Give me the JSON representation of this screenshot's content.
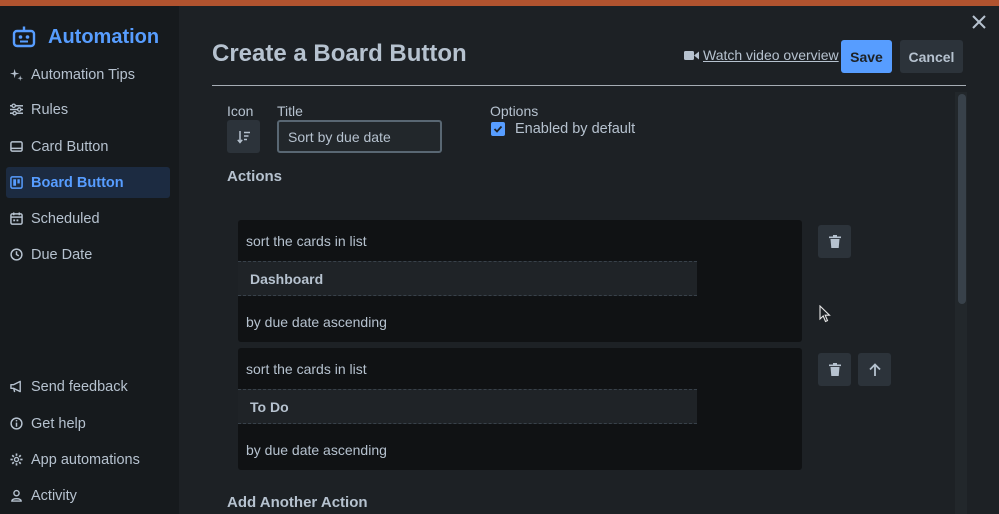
{
  "sidebar": {
    "brand": {
      "title": "Automation",
      "icon": "robot-icon"
    },
    "items": [
      {
        "label": "Automation Tips",
        "icon": "sparkle-icon",
        "active": false
      },
      {
        "label": "Rules",
        "icon": "sliders-icon",
        "active": false
      },
      {
        "label": "Card Button",
        "icon": "card-icon",
        "active": false
      },
      {
        "label": "Board Button",
        "icon": "board-icon",
        "active": true
      },
      {
        "label": "Scheduled",
        "icon": "calendar-icon",
        "active": false
      },
      {
        "label": "Due Date",
        "icon": "clock-icon",
        "active": false
      },
      {
        "label": "Send feedback",
        "icon": "megaphone-icon",
        "active": false
      },
      {
        "label": "Get help",
        "icon": "info-icon",
        "active": false
      },
      {
        "label": "App automations",
        "icon": "gear-icon",
        "active": false
      },
      {
        "label": "Activity",
        "icon": "person-icon",
        "active": false
      }
    ]
  },
  "header": {
    "title": "Create a Board Button",
    "video_link": "Watch video overview",
    "save_label": "Save",
    "cancel_label": "Cancel"
  },
  "form": {
    "icon_label": "Icon",
    "title_label": "Title",
    "title_value": "Sort by due date",
    "options_label": "Options",
    "enabled_label": "Enabled by default",
    "enabled_checked": true
  },
  "actions_heading": "Actions",
  "actions": [
    {
      "line1": "sort the cards in list",
      "list": "Dashboard",
      "line3": "by due date ascending"
    },
    {
      "line1": "sort the cards in list",
      "list": "To Do",
      "line3": "by due date ascending"
    }
  ],
  "add_action_heading": "Add Another Action",
  "colors": {
    "accent": "#579dff",
    "sidebar_bg": "#161a1d",
    "main_bg": "#1d2125",
    "top_bar": "#b0532f"
  }
}
